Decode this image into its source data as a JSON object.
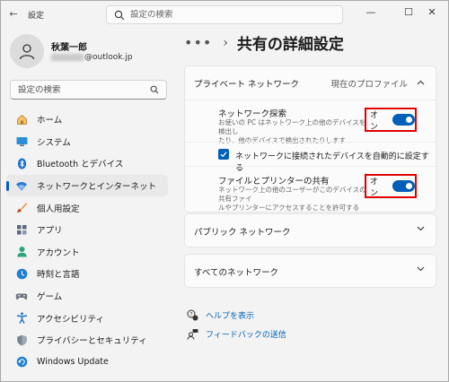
{
  "window": {
    "title": "設定",
    "search_placeholder": "設定の検索",
    "minimize": "—",
    "maximize": "☐",
    "close": "✕"
  },
  "profile": {
    "name": "秋葉一郎",
    "email_suffix": "@outlook.jp"
  },
  "sidebar": {
    "search_placeholder": "設定の検索",
    "items": [
      {
        "label": "ホーム",
        "icon": "home-icon",
        "active": false
      },
      {
        "label": "システム",
        "icon": "system-icon",
        "active": false
      },
      {
        "label": "Bluetooth とデバイス",
        "icon": "bluetooth-icon",
        "active": false
      },
      {
        "label": "ネットワークとインターネット",
        "icon": "network-icon",
        "active": true
      },
      {
        "label": "個人用設定",
        "icon": "brush-icon",
        "active": false
      },
      {
        "label": "アプリ",
        "icon": "apps-icon",
        "active": false
      },
      {
        "label": "アカウント",
        "icon": "account-icon",
        "active": false
      },
      {
        "label": "時刻と言語",
        "icon": "time-language-icon",
        "active": false
      },
      {
        "label": "ゲーム",
        "icon": "gamepad-icon",
        "active": false
      },
      {
        "label": "アクセシビリティ",
        "icon": "accessibility-icon",
        "active": false
      },
      {
        "label": "プライバシーとセキュリティ",
        "icon": "shield-icon",
        "active": false
      },
      {
        "label": "Windows Update",
        "icon": "update-icon",
        "active": false
      }
    ]
  },
  "main": {
    "breadcrumb_more": "•••",
    "breadcrumb_sep": "›",
    "title": "共有の詳細設定",
    "private": {
      "title": "プライベート ネットワーク",
      "status": "現在のプロファイル",
      "discovery": {
        "title": "ネットワーク探索",
        "desc_line1": "お使いの PC はネットワーク上の他のデバイスを検出し",
        "desc_line2": "たり、他のデバイスで検出されたりします",
        "state": "オン",
        "on": true
      },
      "auto_setup": {
        "label": "ネットワークに接続されたデバイスを自動的に設定する",
        "checked": true
      },
      "sharing": {
        "title": "ファイルとプリンターの共有",
        "desc_line1": "ネットワーク上の他のユーザーがこのデバイスの共有ファイ",
        "desc_line2": "ルやプリンターにアクセスすることを許可する",
        "state": "オン",
        "on": true
      }
    },
    "public": {
      "title": "パブリック ネットワーク"
    },
    "all": {
      "title": "すべてのネットワーク"
    },
    "links": {
      "help": "ヘルプを表示",
      "feedback": "フィードバックの送信"
    }
  },
  "colors": {
    "accent": "#005fb8",
    "highlight": "#e00000"
  }
}
